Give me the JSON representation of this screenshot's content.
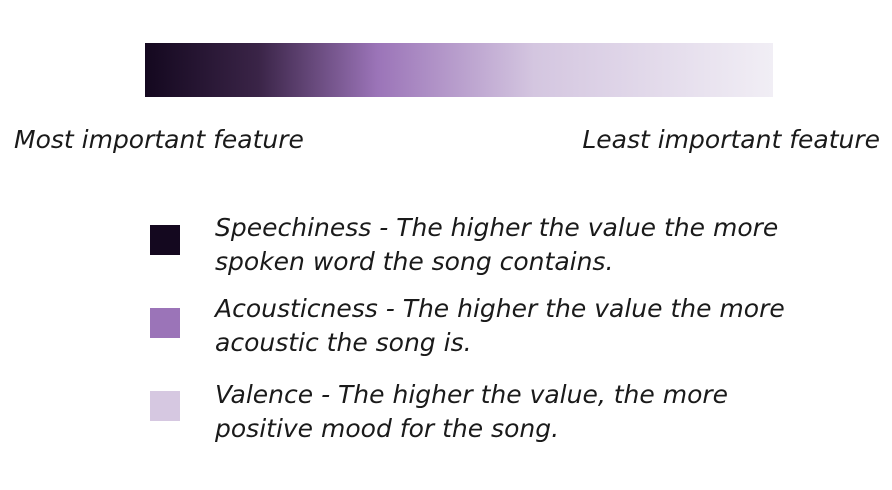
{
  "scale": {
    "gradient_colors": [
      "#14081f",
      "#3a2447",
      "#9b74b8",
      "#d4c6e0",
      "#f1eef5"
    ],
    "left_label": "Most important feature",
    "right_label": "Least important feature"
  },
  "legend": {
    "items": [
      {
        "name": "Speechiness",
        "description_line1": "Speechiness - The higher the value the more",
        "description_line2": "spoken word the song contains.",
        "color": "#14081f"
      },
      {
        "name": "Acousticness",
        "description_line1": "Acousticness - The higher the value the more",
        "description_line2": "acoustic the song is.",
        "color": "#9b74b8"
      },
      {
        "name": "Valence",
        "description_line1": "Valence - The higher the value, the more",
        "description_line2": "positive mood for the song.",
        "color": "#d6c8e1"
      }
    ]
  }
}
